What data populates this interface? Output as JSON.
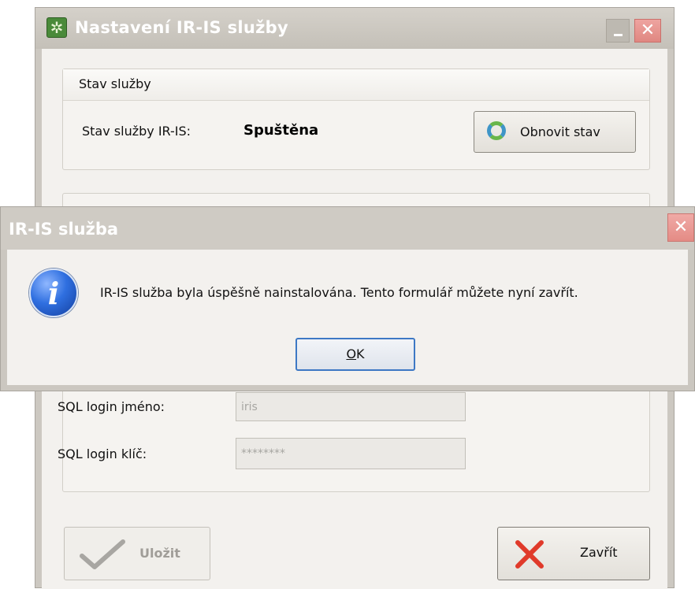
{
  "main_window": {
    "title": "Nastavení IR-IS služby",
    "title_icon": "gear-star-icon",
    "status_group": {
      "title": "Stav služby",
      "status_label": "Stav služby IR-IS:",
      "status_value": "Spuštěna",
      "refresh_button_label": "Obnovit stav",
      "refresh_icon": "refresh-icon"
    },
    "settings_group": {
      "sql_login_label": "SQL login jméno:",
      "sql_login_value": "iris",
      "sql_key_label": "SQL login klíč:",
      "sql_key_value": "********"
    },
    "save_button_label": "Uložit",
    "close_button_label": "Zavřít"
  },
  "dialog": {
    "title": "IR-IS služba",
    "icon": "info-icon",
    "message": "IR-IS služba byla úspěšně nainstalována. Tento formulář můžete nyní zavřít.",
    "ok_underlined": "O",
    "ok_rest": "K"
  },
  "colors": {
    "accent_blue": "#3d78c4",
    "close_red": "#e48b85",
    "delete_red": "#e03a2a",
    "check_gray": "#a8a6a2"
  }
}
